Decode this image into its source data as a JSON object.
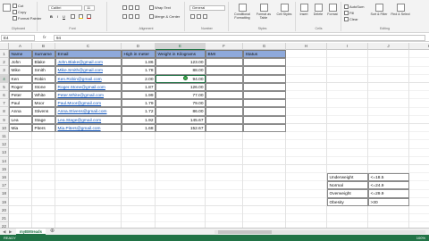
{
  "ribbon": {
    "clipboard": {
      "cut": "Cut",
      "copy": "Copy",
      "format_painter": "Format Painter",
      "group": "Clipboard"
    },
    "font": {
      "family": "Calibri",
      "size": "11",
      "group": "Font",
      "bold": "B",
      "italic": "I",
      "underline": "U"
    },
    "alignment": {
      "wrap_text": "Wrap Text",
      "merge_center": "Merge & Center",
      "group": "Alignment"
    },
    "number": {
      "format": "General",
      "group": "Number"
    },
    "styles": {
      "conditional": "Conditional Formatting",
      "format_table": "Format as Table",
      "cell_styles": "Cell Styles",
      "group": "Styles"
    },
    "cells": {
      "insert": "Insert",
      "delete": "Delete",
      "format": "Format",
      "group": "Cells"
    },
    "editing": {
      "autosum": "AutoSum",
      "fill": "Fill",
      "clear": "Clear",
      "sort_filter": "Sort & Filter",
      "find_select": "Find & Select",
      "group": "Editing"
    }
  },
  "formula_bar": {
    "name_box": "E4",
    "fx": "fx",
    "value": "94"
  },
  "columns": [
    "A",
    "B",
    "C",
    "D",
    "E",
    "F",
    "G",
    "H",
    "I",
    "J",
    "K",
    "L"
  ],
  "rows": [
    "1",
    "2",
    "3",
    "4",
    "5",
    "6",
    "7",
    "8",
    "9",
    "10",
    "11",
    "12",
    "13",
    "14",
    "15",
    "16",
    "17",
    "18",
    "19",
    "20",
    "21",
    "22"
  ],
  "table": {
    "headers": [
      "Name",
      "Surname",
      "Email",
      "High in meter",
      "Weight in Kilograms",
      "BMI",
      "Status"
    ],
    "rows": [
      [
        "John",
        "Blake",
        "John.Blake@gmail.com",
        "1.86",
        "123.00"
      ],
      [
        "Mike",
        "Smith",
        "Mike.Smith@gmail.com",
        "1.78",
        "88.00"
      ],
      [
        "Ken",
        "Robin",
        "Ken.Robin@gmail.com",
        "2.00",
        "94.00"
      ],
      [
        "Roger",
        "Stone",
        "Roger.Stone@gmail.com",
        "1.87",
        "126.00"
      ],
      [
        "Peter",
        "White",
        "Peter.White@gmail.com",
        "1.99",
        "77.00"
      ],
      [
        "Paul",
        "Moor",
        "Paul.Moor@gmail.com",
        "1.79",
        "79.00"
      ],
      [
        "Anna",
        "Stivens",
        "Anna.Stivens@gmail.com",
        "1.72",
        "86.00"
      ],
      [
        "Lea",
        "Stage",
        "Lea.Stage@gmail.com",
        "1.92",
        "145.67"
      ],
      [
        "Mia",
        "Piters",
        "Mia.Piters@gmail.com",
        "1.68",
        "152.67"
      ]
    ]
  },
  "bmi_table": [
    [
      "Underweight",
      "<=18.5"
    ],
    [
      "Normal",
      "<=24.9"
    ],
    [
      "Overweight",
      "<=29.9"
    ],
    [
      "Obesity",
      ">30"
    ]
  ],
  "sheet_tab": "myBMIreads",
  "status_bar": {
    "ready": "READY",
    "zoom": "100%"
  },
  "colors": {
    "accent": "#217346",
    "header_fill": "#8ea9db",
    "link": "#0b50b8"
  }
}
